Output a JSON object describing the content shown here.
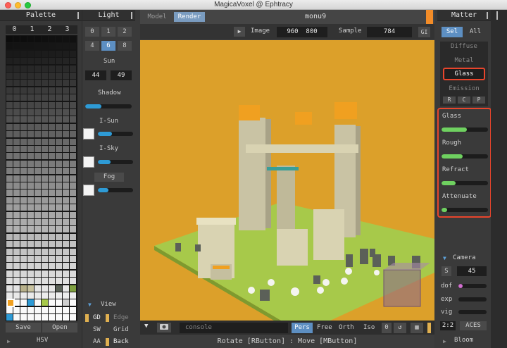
{
  "window": {
    "title": "MagicaVoxel @ Ephtracy"
  },
  "palette": {
    "title": "Palette",
    "tabs": [
      "0",
      "1",
      "2",
      "3"
    ],
    "save_label": "Save",
    "open_label": "Open",
    "hsv_label": "HSV"
  },
  "light": {
    "title": "Light",
    "numbers_row1": [
      "0",
      "1",
      "2"
    ],
    "numbers_row2": [
      "4",
      "6",
      "8"
    ],
    "selected": "6",
    "sun_label": "Sun",
    "sun_values": [
      "44",
      "49"
    ],
    "shadow_label": "Shadow",
    "shadow_level": 0.35,
    "isun_label": "I-Sun",
    "isun_level": 0.4,
    "isky_label": "I-Sky",
    "isky_level": 0.35,
    "fog_label": "Fog",
    "fog_level": 0.3
  },
  "view": {
    "title": "View",
    "rows": [
      {
        "left": "GD",
        "right": "Edge"
      },
      {
        "left": "SW",
        "right": "Grid"
      },
      {
        "left": "AA",
        "right": "Back"
      }
    ]
  },
  "render": {
    "tabs": [
      "Model",
      "Render"
    ],
    "active_tab": "Render",
    "scene_name": "monu9",
    "image_label": "Image",
    "image_width": "960",
    "image_height": "800",
    "sample_label": "Sample",
    "sample_value": "784",
    "gi_label": "GI"
  },
  "bottombar": {
    "console_placeholder": "console",
    "modes": [
      "Pers",
      "Free",
      "Orth",
      "Iso"
    ],
    "active_mode": "Pers",
    "count": "0",
    "status": "Rotate [RButton] : Move [MButton]"
  },
  "matter": {
    "title": "Matter",
    "tabs": [
      "Sel",
      "All"
    ],
    "active_tab": "Sel",
    "types": [
      "Diffuse",
      "Metal",
      "Glass",
      "Emission"
    ],
    "active_type": "Glass",
    "rcp": [
      "R",
      "C",
      "P"
    ],
    "params": [
      {
        "name": "Glass",
        "level": 0.55
      },
      {
        "name": "Rough",
        "level": 0.45
      },
      {
        "name": "Refract",
        "level": 0.3
      },
      {
        "name": "Attenuate",
        "level": 0.12
      }
    ]
  },
  "camera": {
    "title": "Camera",
    "s_label": "S",
    "fov": "45",
    "dof_label": "dof",
    "dof_level": 0.15,
    "exp_label": "exp",
    "vig_label": "vig",
    "ratio": "2:2",
    "aces_label": "ACES",
    "bloom_label": "Bloom"
  },
  "colors": {
    "accent_blue": "#5d8fc2",
    "slider_blue": "#2e9bd6",
    "slider_green": "#6fd160",
    "highlight_red": "#e8452c",
    "sky": "#dca02a",
    "ground": "#a7c94a"
  }
}
